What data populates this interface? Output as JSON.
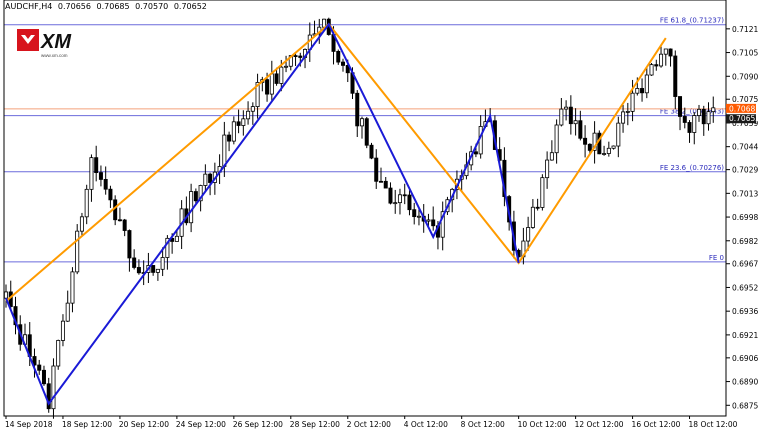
{
  "header": {
    "symbol": "AUDCHF,H4",
    "ohlc": [
      "0.70656",
      "0.70685",
      "0.70570",
      "0.70652"
    ]
  },
  "logo": {
    "name": "XM",
    "tagline": "www.xm.com"
  },
  "colors": {
    "background": "#ffffff",
    "candle": "#000000",
    "zigzag_blue": "#1a1ad6",
    "zigzag_orange": "#ff9b00",
    "fib_line": "#6b6bdc",
    "fib_text": "#2b2bbb",
    "price_line": "#f4a07a",
    "current_tag": "#ff5a00",
    "bid_tag": "#1a1a1a"
  },
  "chart_data": {
    "type": "candlestick",
    "y_range": [
      0.6868,
      0.7132
    ],
    "y_ticks": [
      "0.71210",
      "0.71055",
      "0.70900",
      "0.70750",
      "0.70595",
      "0.70440",
      "0.70290",
      "0.70135",
      "0.69980",
      "0.69825",
      "0.69675",
      "0.69520",
      "0.69365",
      "0.69210",
      "0.69060",
      "0.68905",
      "0.68750"
    ],
    "x_labels": [
      "14 Sep 2018",
      "18 Sep 12:00",
      "20 Sep 12:00",
      "24 Sep 12:00",
      "26 Sep 12:00",
      "28 Sep 12:00",
      "2 Oct 12:00",
      "4 Oct 12:00",
      "8 Oct 12:00",
      "10 Oct 12:00",
      "12 Oct 12:00",
      "16 Oct 12:00",
      "18 Oct 12:00"
    ],
    "bars_count": 150,
    "fib_levels": [
      {
        "label": "FE 61.8_(0.71237)",
        "value": 0.71237
      },
      {
        "label": "FE 38.2_(0.70643)",
        "value": 0.70643
      },
      {
        "label": "FE 23.6_(0.70276)",
        "value": 0.70276
      },
      {
        "label": "FE 0",
        "value": 0.69687
      }
    ],
    "current_price": {
      "label": "0.70687",
      "value": 0.70687
    },
    "bid_price": {
      "label": "0.70652",
      "value": 0.70652
    },
    "zigzag_blue": [
      {
        "bar": 0,
        "price": 0.6945
      },
      {
        "bar": 9,
        "price": 0.6876
      },
      {
        "bar": 68,
        "price": 0.7124
      },
      {
        "bar": 90,
        "price": 0.6985
      },
      {
        "bar": 102,
        "price": 0.7064
      },
      {
        "bar": 108,
        "price": 0.6968
      }
    ],
    "zigzag_orange": [
      {
        "bar": 0,
        "price": 0.6943
      },
      {
        "bar": 68,
        "price": 0.7124
      },
      {
        "bar": 108,
        "price": 0.6968
      },
      {
        "bar": 139,
        "price": 0.7115
      }
    ],
    "pivots": [
      {
        "bar": 0,
        "price": 0.6945
      },
      {
        "bar": 9,
        "price": 0.6876
      },
      {
        "bar": 18,
        "price": 0.7035
      },
      {
        "bar": 29,
        "price": 0.6955
      },
      {
        "bar": 52,
        "price": 0.7075
      },
      {
        "bar": 68,
        "price": 0.7124
      },
      {
        "bar": 78,
        "price": 0.7025
      },
      {
        "bar": 90,
        "price": 0.6985
      },
      {
        "bar": 102,
        "price": 0.7064
      },
      {
        "bar": 108,
        "price": 0.6968
      },
      {
        "bar": 117,
        "price": 0.7066
      },
      {
        "bar": 126,
        "price": 0.704
      },
      {
        "bar": 139,
        "price": 0.7115
      },
      {
        "bar": 142,
        "price": 0.7062
      }
    ]
  }
}
